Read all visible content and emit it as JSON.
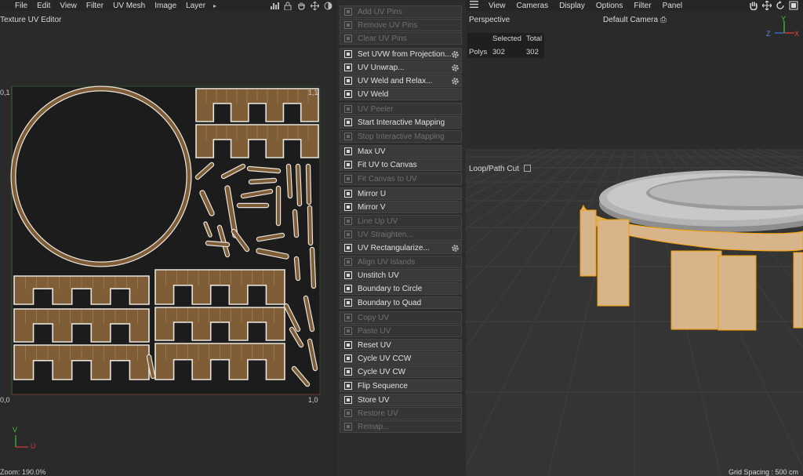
{
  "uv_editor": {
    "menus": [
      "File",
      "Edit",
      "View",
      "Filter",
      "UV Mesh",
      "Image",
      "Layer"
    ],
    "more_glyph": "▸",
    "title": "Texture UV Editor",
    "tl_label": "0,1",
    "tr_label": "1,1",
    "bl_label": "0,0",
    "br_label": "1,0",
    "axis_v": "V",
    "axis_u": "U",
    "zoom": "Zoom: 190.0%",
    "tool_icons": [
      "histogram-icon",
      "lock-icon",
      "hand-icon",
      "move-icon",
      "toggle-icon"
    ]
  },
  "commands": [
    {
      "label": "Add UV Pins",
      "enabled": false,
      "gear": false,
      "icon": "pin-icon"
    },
    {
      "label": "Remove UV Pins",
      "enabled": false,
      "gear": false,
      "icon": "unpin-icon"
    },
    {
      "label": "Clear UV Pins",
      "enabled": false,
      "gear": false,
      "icon": "clear-icon"
    },
    {
      "label": "Set UVW from Projection...",
      "enabled": true,
      "gear": true,
      "icon": "projection-icon"
    },
    {
      "label": "UV Unwrap...",
      "enabled": true,
      "gear": true,
      "icon": "unwrap-icon"
    },
    {
      "label": "UV Weld and Relax...",
      "enabled": true,
      "gear": true,
      "icon": "weld-relax-icon"
    },
    {
      "label": "UV Weld",
      "enabled": true,
      "gear": false,
      "icon": "weld-icon"
    },
    {
      "label": "UV Peeler",
      "enabled": false,
      "gear": false,
      "icon": "peeler-icon"
    },
    {
      "label": "Start Interactive Mapping",
      "enabled": true,
      "gear": false,
      "icon": "play-icon"
    },
    {
      "label": "Stop Interactive Mapping",
      "enabled": false,
      "gear": false,
      "icon": "stop-icon"
    },
    {
      "label": "Max UV",
      "enabled": true,
      "gear": false,
      "icon": "max-uv-icon"
    },
    {
      "label": "Fit UV to Canvas",
      "enabled": true,
      "gear": false,
      "icon": "fit-uv-icon"
    },
    {
      "label": "Fit Canvas to UV",
      "enabled": false,
      "gear": false,
      "icon": "fit-canvas-icon"
    },
    {
      "label": "Mirror U",
      "enabled": true,
      "gear": false,
      "icon": "mirror-u-icon"
    },
    {
      "label": "Mirror V",
      "enabled": true,
      "gear": false,
      "icon": "mirror-v-icon"
    },
    {
      "label": "Line Up UV",
      "enabled": false,
      "gear": false,
      "icon": "line-up-icon"
    },
    {
      "label": "UV Straighten...",
      "enabled": false,
      "gear": false,
      "icon": "straighten-icon"
    },
    {
      "label": "UV Rectangularize...",
      "enabled": true,
      "gear": true,
      "icon": "rectangularize-icon"
    },
    {
      "label": "Align UV Islands",
      "enabled": false,
      "gear": false,
      "icon": "align-icon"
    },
    {
      "label": "Unstitch UV",
      "enabled": true,
      "gear": false,
      "icon": "unstitch-icon"
    },
    {
      "label": "Boundary to Circle",
      "enabled": true,
      "gear": false,
      "icon": "circle-icon"
    },
    {
      "label": "Boundary to Quad",
      "enabled": true,
      "gear": false,
      "icon": "quad-icon"
    },
    {
      "label": "Copy UV",
      "enabled": false,
      "gear": false,
      "icon": "copy-icon"
    },
    {
      "label": "Paste UV",
      "enabled": false,
      "gear": false,
      "icon": "paste-icon"
    },
    {
      "label": "Reset UV",
      "enabled": true,
      "gear": false,
      "icon": "reset-icon"
    },
    {
      "label": "Cycle UV CCW",
      "enabled": true,
      "gear": false,
      "icon": "cycle-ccw-icon"
    },
    {
      "label": "Cycle UV CW",
      "enabled": true,
      "gear": false,
      "icon": "cycle-cw-icon"
    },
    {
      "label": "Flip Sequence",
      "enabled": true,
      "gear": false,
      "icon": "flip-icon"
    },
    {
      "label": "Store UV",
      "enabled": true,
      "gear": false,
      "icon": "store-icon"
    },
    {
      "label": "Restore UV",
      "enabled": false,
      "gear": false,
      "icon": "restore-icon"
    },
    {
      "label": "Remap...",
      "enabled": false,
      "gear": false,
      "icon": "remap-icon"
    }
  ],
  "viewport": {
    "menus": [
      "View",
      "Cameras",
      "Display",
      "Options",
      "Filter",
      "Panel"
    ],
    "name": "Perspective",
    "camera": "Default Camera",
    "camera_glyph": "⎙",
    "stats": {
      "col_selected": "Selected",
      "col_total": "Total",
      "row_label": "Polys",
      "selected": "302",
      "total": "302"
    },
    "tool": "Loop/Path Cut",
    "grid_spacing": "Grid Spacing : 500 cm",
    "axis_y": "Y",
    "axis_z": "Z",
    "axis_x": "X",
    "tool_icons": [
      "hand-icon",
      "move-icon",
      "rotate-icon",
      "maximize-icon"
    ]
  },
  "colors": {
    "uv_fill": "#7f5d36",
    "uv_outline": "#e8e4dc",
    "uv_edge": "#b08a55",
    "selection_orange": "#f5a000",
    "panel_bg": "#2a2a2a",
    "button_bg": "#3a3a3a"
  }
}
